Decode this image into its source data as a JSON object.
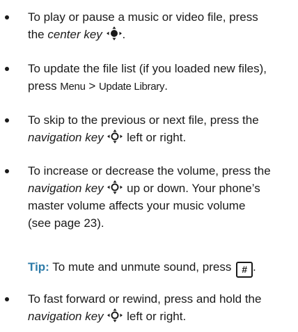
{
  "bullets": [
    {
      "line1": "To play or pause a music or video file, press",
      "line2_prefix": "the ",
      "key_name": "center key",
      "line2_suffix": "."
    },
    {
      "line1": "To update the file list (if you loaded new files),",
      "line2_prefix": "press ",
      "menu": "Menu",
      "separator": " > ",
      "menu_item": "Update Library",
      "line2_suffix": "."
    },
    {
      "line1": "To skip to the previous or next file, press the",
      "key_name": "navigation key",
      "line2_suffix": " left or right."
    },
    {
      "line1": "To increase or decrease the volume, press the",
      "key_name": "navigation key",
      "line2_suffix": " up or down. Your phone’s",
      "line3": "master volume affects your music volume",
      "line4": "(see page 23)."
    },
    {
      "line1": "To fast forward or rewind, press and hold the",
      "key_name": "navigation key",
      "line2_suffix": " left or right."
    }
  ],
  "tip": {
    "label": "Tip:",
    "text": " To mute and unmute sound, press ",
    "key": "#",
    "suffix": "."
  },
  "icons": {
    "center_key": "center-key-icon",
    "navigation_key": "navigation-key-icon",
    "pound_key": "pound-key-icon"
  },
  "colors": {
    "tip_label": "#2d7ba8",
    "text": "#1a1a1a"
  }
}
